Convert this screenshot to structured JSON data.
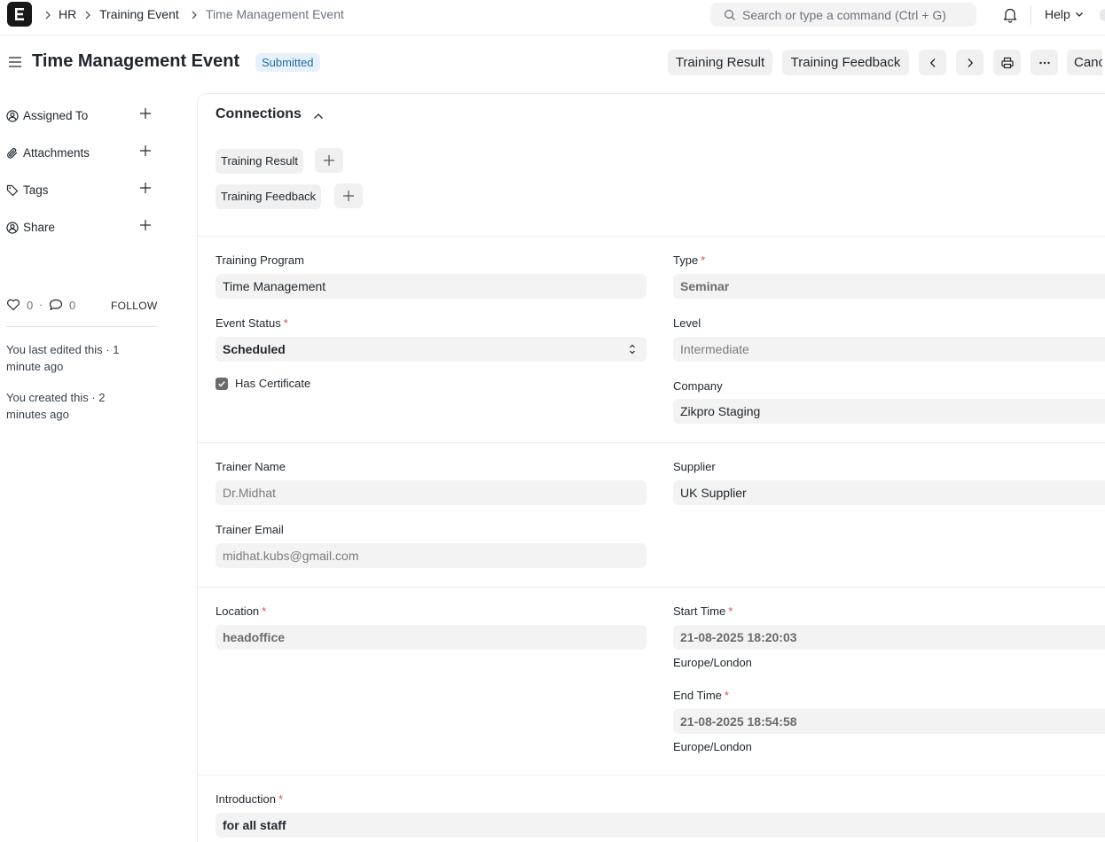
{
  "navbar": {
    "logo_letter": "E",
    "breadcrumbs": [
      "HR",
      "Training Event",
      "Time Management Event"
    ],
    "search_placeholder": "Search or type a command (Ctrl + G)",
    "help_label": "Help"
  },
  "page": {
    "title": "Time Management Event",
    "status_badge": "Submitted",
    "actions": {
      "training_result": "Training Result",
      "training_feedback": "Training Feedback",
      "cancel": "Cancel"
    }
  },
  "sidebar": {
    "items": [
      {
        "label": "Assigned To",
        "icon": "assign-user-icon"
      },
      {
        "label": "Attachments",
        "icon": "paperclip-icon"
      },
      {
        "label": "Tags",
        "icon": "tag-icon"
      },
      {
        "label": "Share",
        "icon": "share-user-icon"
      }
    ],
    "likes": "0",
    "comments": "0",
    "follow_label": "FOLLOW",
    "last_edited": "You last edited this · 1 minute ago",
    "created": "You created this · 2 minutes ago"
  },
  "connections": {
    "title": "Connections",
    "links": [
      "Training Result",
      "Training Feedback"
    ]
  },
  "form": {
    "training_program": {
      "label": "Training Program",
      "value": "Time Management"
    },
    "type": {
      "label": "Type",
      "value": "Seminar",
      "required": "*"
    },
    "event_status": {
      "label": "Event Status",
      "value": "Scheduled",
      "required": "*"
    },
    "level": {
      "label": "Level",
      "placeholder": "Intermediate"
    },
    "has_certificate": {
      "label": "Has Certificate",
      "checked": true
    },
    "company": {
      "label": "Company",
      "value": "Zikpro Staging"
    },
    "trainer_name": {
      "label": "Trainer Name",
      "value": "Dr.Midhat"
    },
    "supplier": {
      "label": "Supplier",
      "value": "UK Supplier"
    },
    "trainer_email": {
      "label": "Trainer Email",
      "value": "midhat.kubs@gmail.com"
    },
    "location": {
      "label": "Location",
      "value": "headoffice",
      "required": "*"
    },
    "start_time": {
      "label": "Start Time",
      "value": "21-08-2025 18:20:03",
      "timezone": "Europe/London",
      "required": "*"
    },
    "end_time": {
      "label": "End Time",
      "value": "21-08-2025 18:54:58",
      "timezone": "Europe/London",
      "required": "*"
    },
    "introduction": {
      "label": "Introduction",
      "value": "for all staff",
      "required": "*"
    }
  },
  "colors": {
    "badge_text": "#1e6aa5",
    "badge_bg": "#e6f1fb",
    "required": "#e24c4c",
    "field_bg": "#f3f3f3"
  }
}
